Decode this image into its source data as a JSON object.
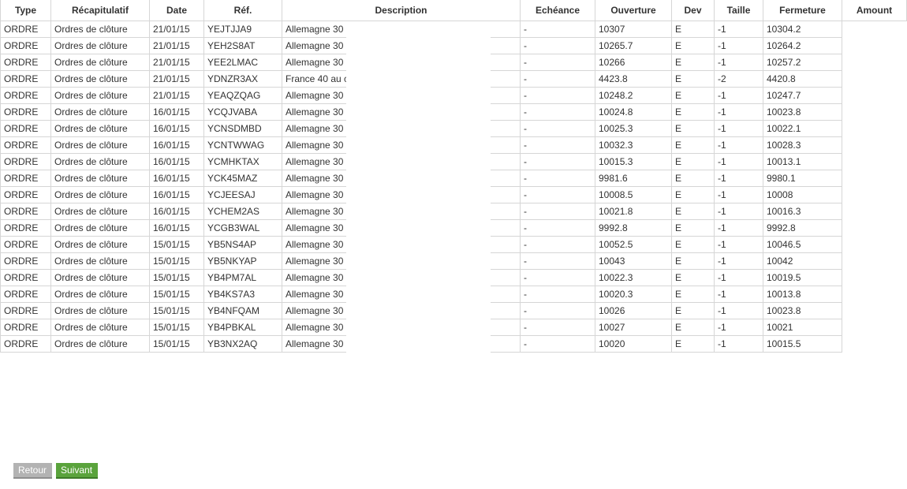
{
  "table": {
    "headers": {
      "type": "Type",
      "summary": "Récapitulatif",
      "date": "Date",
      "ref": "Réf.",
      "description": "Description",
      "expiry": "Echéance",
      "open": "Ouverture",
      "currency": "Dev",
      "size": "Taille",
      "close": "Fermeture",
      "amount": "Amount"
    },
    "rows": [
      {
        "type": "ORDRE",
        "summary": "Ordres de clôture",
        "date": "21/01/15",
        "ref": "YEJTJJA9",
        "description": "Allemagne 30",
        "expiry": "-",
        "open": "10307",
        "currency": "E",
        "size": "-1",
        "close": "10304.2"
      },
      {
        "type": "ORDRE",
        "summary": "Ordres de clôture",
        "date": "21/01/15",
        "ref": "YEH2S8AT",
        "description": "Allemagne 30",
        "expiry": "-",
        "open": "10265.7",
        "currency": "E",
        "size": "-1",
        "close": "10264.2"
      },
      {
        "type": "ORDRE",
        "summary": "Ordres de clôture",
        "date": "21/01/15",
        "ref": "YEE2LMAC",
        "description": "Allemagne 30",
        "expiry": "-",
        "open": "10266",
        "currency": "E",
        "size": "-1",
        "close": "10257.2"
      },
      {
        "type": "ORDRE",
        "summary": "Ordres de clôture",
        "date": "21/01/15",
        "ref": "YDNZR3AX",
        "description": "France 40 au c",
        "expiry": "-",
        "open": "4423.8",
        "currency": "E",
        "size": "-2",
        "close": "4420.8"
      },
      {
        "type": "ORDRE",
        "summary": "Ordres de clôture",
        "date": "21/01/15",
        "ref": "YEAQZQAG",
        "description": "Allemagne 30",
        "expiry": "-",
        "open": "10248.2",
        "currency": "E",
        "size": "-1",
        "close": "10247.7"
      },
      {
        "type": "ORDRE",
        "summary": "Ordres de clôture",
        "date": "16/01/15",
        "ref": "YCQJVABA",
        "description": "Allemagne 30",
        "expiry": "-",
        "open": "10024.8",
        "currency": "E",
        "size": "-1",
        "close": "10023.8"
      },
      {
        "type": "ORDRE",
        "summary": "Ordres de clôture",
        "date": "16/01/15",
        "ref": "YCNSDMBD",
        "description": "Allemagne 30",
        "expiry": "-",
        "open": "10025.3",
        "currency": "E",
        "size": "-1",
        "close": "10022.1"
      },
      {
        "type": "ORDRE",
        "summary": "Ordres de clôture",
        "date": "16/01/15",
        "ref": "YCNTWWAG",
        "description": "Allemagne 30",
        "expiry": "-",
        "open": "10032.3",
        "currency": "E",
        "size": "-1",
        "close": "10028.3"
      },
      {
        "type": "ORDRE",
        "summary": "Ordres de clôture",
        "date": "16/01/15",
        "ref": "YCMHKTAX",
        "description": "Allemagne 30",
        "expiry": "-",
        "open": "10015.3",
        "currency": "E",
        "size": "-1",
        "close": "10013.1"
      },
      {
        "type": "ORDRE",
        "summary": "Ordres de clôture",
        "date": "16/01/15",
        "ref": "YCK45MAZ",
        "description": "Allemagne 30",
        "expiry": "-",
        "open": "9981.6",
        "currency": "E",
        "size": "-1",
        "close": "9980.1"
      },
      {
        "type": "ORDRE",
        "summary": "Ordres de clôture",
        "date": "16/01/15",
        "ref": "YCJEESAJ",
        "description": "Allemagne 30",
        "expiry": "-",
        "open": "10008.5",
        "currency": "E",
        "size": "-1",
        "close": "10008"
      },
      {
        "type": "ORDRE",
        "summary": "Ordres de clôture",
        "date": "16/01/15",
        "ref": "YCHEM2AS",
        "description": "Allemagne 30",
        "expiry": "-",
        "open": "10021.8",
        "currency": "E",
        "size": "-1",
        "close": "10016.3"
      },
      {
        "type": "ORDRE",
        "summary": "Ordres de clôture",
        "date": "16/01/15",
        "ref": "YCGB3WAL",
        "description": "Allemagne 30",
        "expiry": "-",
        "open": "9992.8",
        "currency": "E",
        "size": "-1",
        "close": "9992.8"
      },
      {
        "type": "ORDRE",
        "summary": "Ordres de clôture",
        "date": "15/01/15",
        "ref": "YB5NS4AP",
        "description": "Allemagne 30",
        "expiry": "-",
        "open": "10052.5",
        "currency": "E",
        "size": "-1",
        "close": "10046.5"
      },
      {
        "type": "ORDRE",
        "summary": "Ordres de clôture",
        "date": "15/01/15",
        "ref": "YB5NKYAP",
        "description": "Allemagne 30",
        "expiry": "-",
        "open": "10043",
        "currency": "E",
        "size": "-1",
        "close": "10042"
      },
      {
        "type": "ORDRE",
        "summary": "Ordres de clôture",
        "date": "15/01/15",
        "ref": "YB4PM7AL",
        "description": "Allemagne 30",
        "expiry": "-",
        "open": "10022.3",
        "currency": "E",
        "size": "-1",
        "close": "10019.5"
      },
      {
        "type": "ORDRE",
        "summary": "Ordres de clôture",
        "date": "15/01/15",
        "ref": "YB4KS7A3",
        "description": "Allemagne 30",
        "expiry": "-",
        "open": "10020.3",
        "currency": "E",
        "size": "-1",
        "close": "10013.8"
      },
      {
        "type": "ORDRE",
        "summary": "Ordres de clôture",
        "date": "15/01/15",
        "ref": "YB4NFQAM",
        "description": "Allemagne 30",
        "expiry": "-",
        "open": "10026",
        "currency": "E",
        "size": "-1",
        "close": "10023.8"
      },
      {
        "type": "ORDRE",
        "summary": "Ordres de clôture",
        "date": "15/01/15",
        "ref": "YB4PBKAL",
        "description": "Allemagne 30",
        "expiry": "-",
        "open": "10027",
        "currency": "E",
        "size": "-1",
        "close": "10021"
      },
      {
        "type": "ORDRE",
        "summary": "Ordres de clôture",
        "date": "15/01/15",
        "ref": "YB3NX2AQ",
        "description": "Allemagne 30",
        "expiry": "-",
        "open": "10020",
        "currency": "E",
        "size": "-1",
        "close": "10015.5"
      }
    ]
  },
  "pagination": {
    "prev_label": "Retour",
    "next_label": "Suivant"
  },
  "colors": {
    "border": "#d6d6d6",
    "prev_button": "#b3b3b3",
    "next_button": "#5aa33c"
  }
}
